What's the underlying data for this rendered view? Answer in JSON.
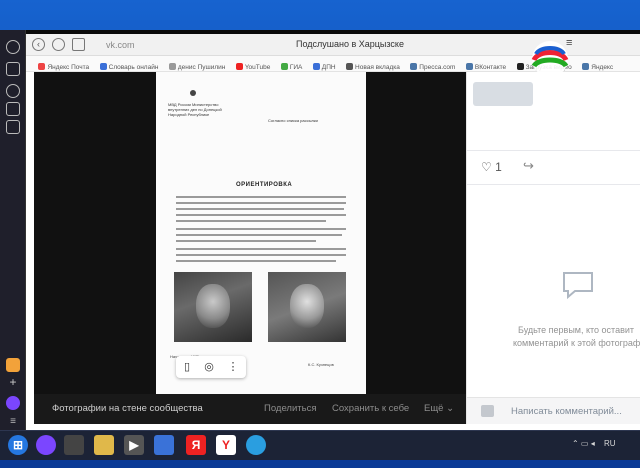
{
  "browser": {
    "url": "vk.com",
    "title": "Подслушано в Харцызске"
  },
  "bookmarks": [
    "Яндекс Почта",
    "Словарь онлайн",
    "денис Пушилин",
    "YouTube",
    "ГИА",
    "ДПН",
    "Новая вкладка",
    "Пресса.com",
    "ВКонтакте",
    "Загрузка видео",
    "Яндекс"
  ],
  "document": {
    "header": "МВД России Министерство внутренних дел по Донецкой Народной Республике",
    "stamp": "Согласно списка рассылки",
    "title": "ОРИЕНТИРОВКА",
    "footer_left": "Начальник УУР",
    "footer_right": "К.С. Кузнецов"
  },
  "viewer": {
    "album": "Фотографии на стене сообщества",
    "share": "Поделиться",
    "save": "Сохранить к себе",
    "more": "Ещё ⌄"
  },
  "panel": {
    "likes": "1",
    "empty_line1": "Будьте первым, кто оставит",
    "empty_line2": "комментарий к этой фотографии.",
    "placeholder": "Написать комментарий..."
  },
  "taskbar": {
    "yandex": "Я",
    "y": "Y",
    "lang": "RU"
  }
}
